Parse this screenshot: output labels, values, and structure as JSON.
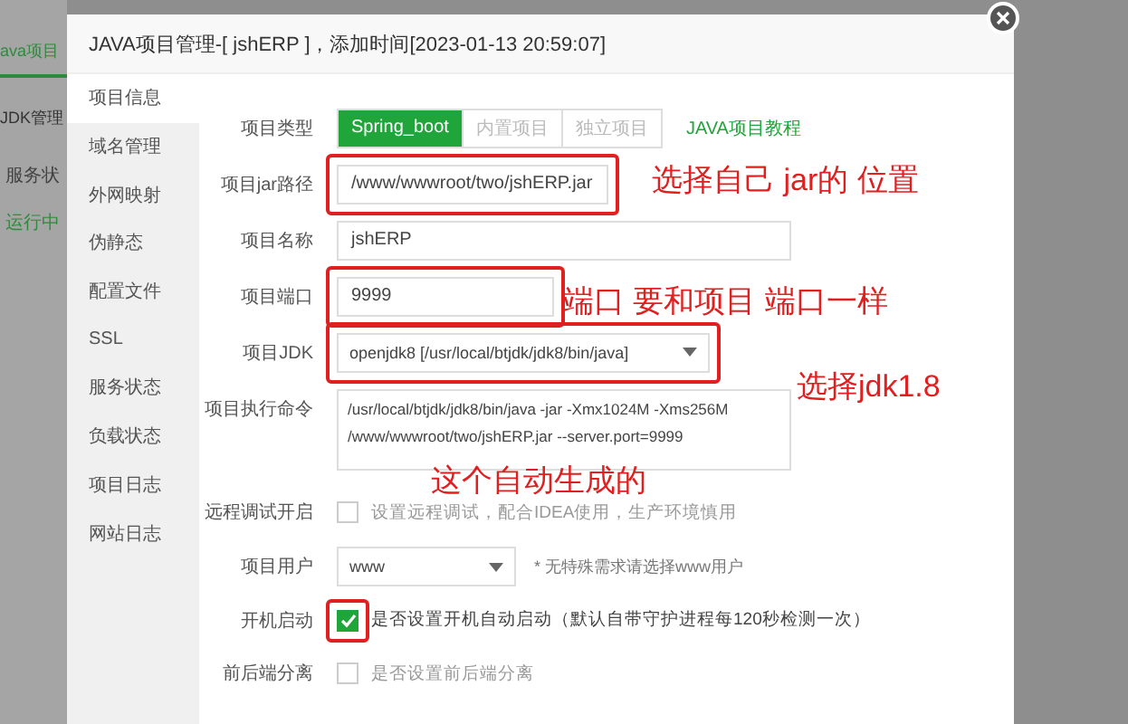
{
  "background": {
    "tabs": [
      {
        "label": "ava项目",
        "selected": true
      },
      {
        "label": "JDK管理",
        "selected": false
      }
    ],
    "column_label": "服务状",
    "status": "运行中"
  },
  "dialog": {
    "title": "JAVA项目管理-[ jshERP ]，添加时间[2023-01-13 20:59:07]",
    "sidebar": [
      {
        "label": "项目信息",
        "selected": true
      },
      {
        "label": "域名管理",
        "selected": false
      },
      {
        "label": "外网映射",
        "selected": false
      },
      {
        "label": "伪静态",
        "selected": false
      },
      {
        "label": "配置文件",
        "selected": false
      },
      {
        "label": "SSL",
        "selected": false
      },
      {
        "label": "服务状态",
        "selected": false
      },
      {
        "label": "负载状态",
        "selected": false
      },
      {
        "label": "项目日志",
        "selected": false
      },
      {
        "label": "网站日志",
        "selected": false
      }
    ],
    "form": [
      {
        "kind": "segmented",
        "label": "项目类型",
        "options": [
          {
            "label": "Spring_boot",
            "selected": true
          },
          {
            "label": "内置项目",
            "selected": false
          },
          {
            "label": "独立项目",
            "selected": false
          }
        ],
        "link": "JAVA项目教程"
      },
      {
        "kind": "input",
        "label": "项目jar路径",
        "value": "/www/wwwroot/two/jshERP.jar",
        "highlighted": true,
        "short": false
      },
      {
        "kind": "input",
        "label": "项目名称",
        "value": "jshERP",
        "highlighted": false,
        "short": false
      },
      {
        "kind": "input",
        "label": "项目端口",
        "value": "9999",
        "highlighted": true,
        "short": true
      },
      {
        "kind": "select",
        "label": "项目JDK",
        "value": "openjdk8 [/usr/local/btjdk/jdk8/bin/java]",
        "highlighted": true
      },
      {
        "kind": "textarea",
        "label": "项目执行命令",
        "value": "/usr/local/btjdk/jdk8/bin/java -jar -Xmx1024M -Xms256M  /www/wwwroot/two/jshERP.jar --server.port=9999"
      },
      {
        "kind": "checkbox",
        "label": "远程调试开启",
        "text": "设置远程调试，配合IDEA使用，生产环境慎用",
        "checked": false,
        "highlighted": false
      },
      {
        "kind": "user",
        "label": "项目用户",
        "value": "www",
        "hint": "* 无特殊需求请选择www用户"
      },
      {
        "kind": "checkbox",
        "label": "开机启动",
        "text": "是否设置开机自动启动（默认自带守护进程每120秒检测一次）",
        "checked": true,
        "highlighted": true
      },
      {
        "kind": "checkbox",
        "label": "前后端分离",
        "text": "是否设置前后端分离",
        "checked": false,
        "highlighted": false
      }
    ]
  },
  "annotations": [
    "选择自己 jar的 位置",
    "端口 要和项目 端口一样",
    "选择jdk1.8",
    "这个自动生成的"
  ]
}
